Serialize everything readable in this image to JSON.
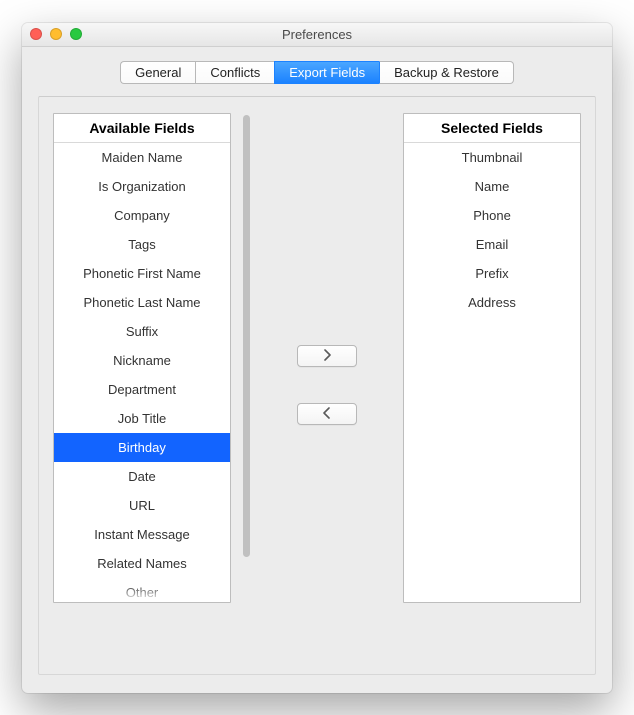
{
  "window": {
    "title": "Preferences"
  },
  "tabs": [
    {
      "label": "General",
      "active": false
    },
    {
      "label": "Conflicts",
      "active": false
    },
    {
      "label": "Export Fields",
      "active": true
    },
    {
      "label": "Backup & Restore",
      "active": false
    }
  ],
  "available": {
    "header": "Available Fields",
    "items": [
      "Maiden Name",
      "Is Organization",
      "Company",
      "Tags",
      "Phonetic First Name",
      "Phonetic Last Name",
      "Suffix",
      "Nickname",
      "Department",
      "Job Title",
      "Birthday",
      "Date",
      "URL",
      "Instant Message",
      "Related Names",
      "Other"
    ],
    "selected_index": 10
  },
  "selected": {
    "header": "Selected Fields",
    "items": [
      "Thumbnail",
      "Name",
      "Phone",
      "Email",
      "Prefix",
      "Address"
    ],
    "selected_index": -1
  },
  "colors": {
    "accent": "#1b82ff",
    "selection": "#1264ff"
  }
}
